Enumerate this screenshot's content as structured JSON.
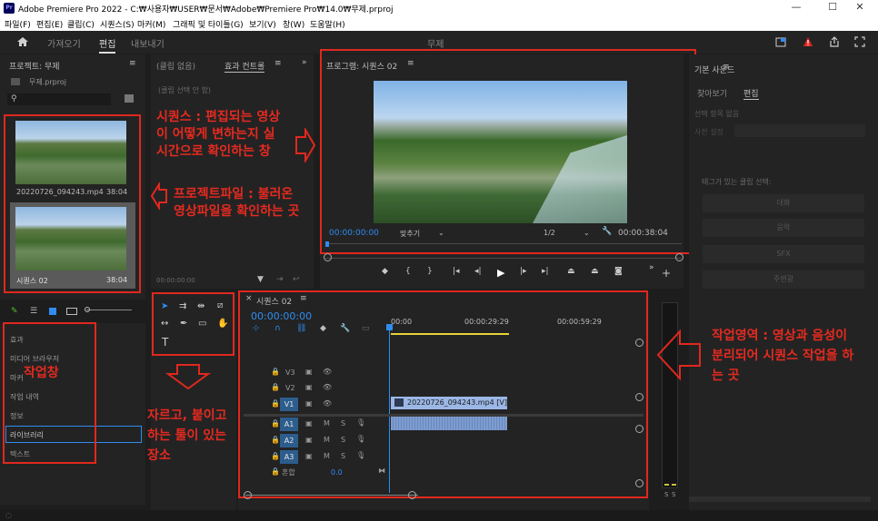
{
  "titlebar": {
    "title": "Adobe Premiere Pro 2022 - C:₩사용자₩USER₩문서₩Adobe₩Premiere Pro₩14.0₩무제.prproj",
    "minimize": "—",
    "maximize": "☐",
    "close": "✕"
  },
  "menu": [
    "파일(F)",
    "편집(E)",
    "클립(C)",
    "시퀀스(S)",
    "마커(M)",
    "그래픽 및 타이틀(G)",
    "보기(V)",
    "창(W)",
    "도움말(H)"
  ],
  "workspace": {
    "home_icon": "home-icon",
    "tabs": [
      "가져오기",
      "편집",
      "내보내기"
    ],
    "active_tab": "편집",
    "center_title": "무제"
  },
  "project_panel": {
    "title": "프로젝트: 무제",
    "file": "무제.prproj",
    "items": [
      {
        "name": "20220726_094243.mp4",
        "duration": "38:04"
      },
      {
        "name": "시퀀스 02",
        "duration": "38:04"
      }
    ]
  },
  "effects_panel": {
    "tab1": "(클립 없음)",
    "tab2": "효과 컨트롤",
    "no_clip": "(클립 선택 안 함)",
    "timecode": "00:00:00:00"
  },
  "program_monitor": {
    "title": "프로그램: 시퀀스 02",
    "timecode": "00:00:00:00",
    "fit": "맞추기",
    "quality": "1/2",
    "duration": "00:00:38:04"
  },
  "tools_panel": {},
  "browser_panel": {
    "items": [
      "효과",
      "미디어 브라우저",
      "마커",
      "작업 내역",
      "정보",
      "라이브러리",
      "텍스트"
    ]
  },
  "timeline": {
    "title": "시퀀스 02",
    "timecode": "00:00:00:00",
    "ruler": [
      "00:00",
      "00:00:29:29",
      "00:00:59:29"
    ],
    "video_tracks": [
      "V3",
      "V2",
      "V1"
    ],
    "audio_tracks": [
      "A1",
      "A2",
      "A3"
    ],
    "mix_label": "혼합",
    "mix_value": "0.0",
    "video_clip": "20220726_094243.mp4 [V]"
  },
  "essential_sound": {
    "title": "기본 사운드",
    "tab1": "찾아보기",
    "tab2": "편집",
    "no_selection": "선택 항목 없음",
    "preset": "사전 설정",
    "tag_label": "태그가 있는 클립 선택:",
    "buttons": [
      "대화",
      "음악",
      "SFX",
      "주변광"
    ]
  },
  "meter": {
    "labels": [
      "S",
      "S"
    ]
  },
  "annotations": {
    "sequence": "시퀀스 : 편집되는 영상\n이 어떻게 변하는지 실\n시간으로 확인하는 창",
    "project": "프로젝트파일 : 불러온\n영상파일을 확인하는 곳",
    "workpanel": "작업창",
    "tools": "자르고, 붙이고\n하는 툴이 있는\n장소",
    "timeline": "작업영역 : 영상과 음성이\n분리되어 시퀀스 작업을 하\n는 곳"
  },
  "colors": {
    "annotation_red": "#e0281e",
    "accent_blue": "#2f8cf0",
    "track_blue": "#2d5d8d"
  }
}
